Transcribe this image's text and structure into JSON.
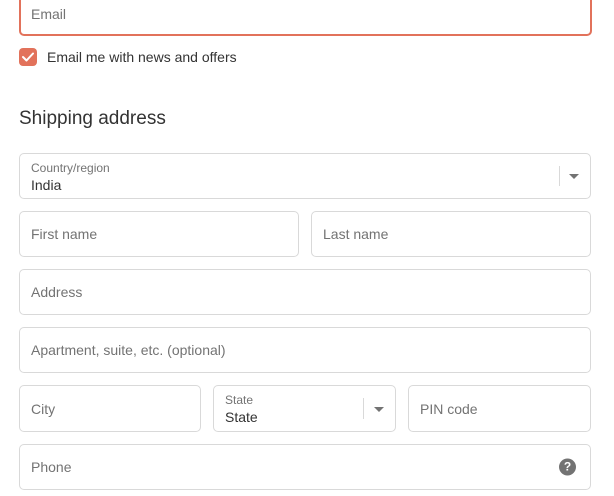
{
  "contact": {
    "email_placeholder": "Email",
    "news_checkbox": {
      "checked": true,
      "label": "Email me with news and offers"
    }
  },
  "shipping": {
    "title": "Shipping address",
    "country": {
      "label": "Country/region",
      "value": "India"
    },
    "first_name_placeholder": "First name",
    "last_name_placeholder": "Last name",
    "address_placeholder": "Address",
    "apartment_placeholder": "Apartment, suite, etc. (optional)",
    "city_placeholder": "City",
    "state": {
      "label": "State",
      "value": "State"
    },
    "pin_placeholder": "PIN code",
    "phone_placeholder": "Phone",
    "phone_help_icon": "question-circle-icon",
    "help_glyph": "?"
  },
  "colors": {
    "accent": "#e2725b",
    "border": "#d9d9d9",
    "placeholder": "#737373",
    "text": "#333333"
  }
}
